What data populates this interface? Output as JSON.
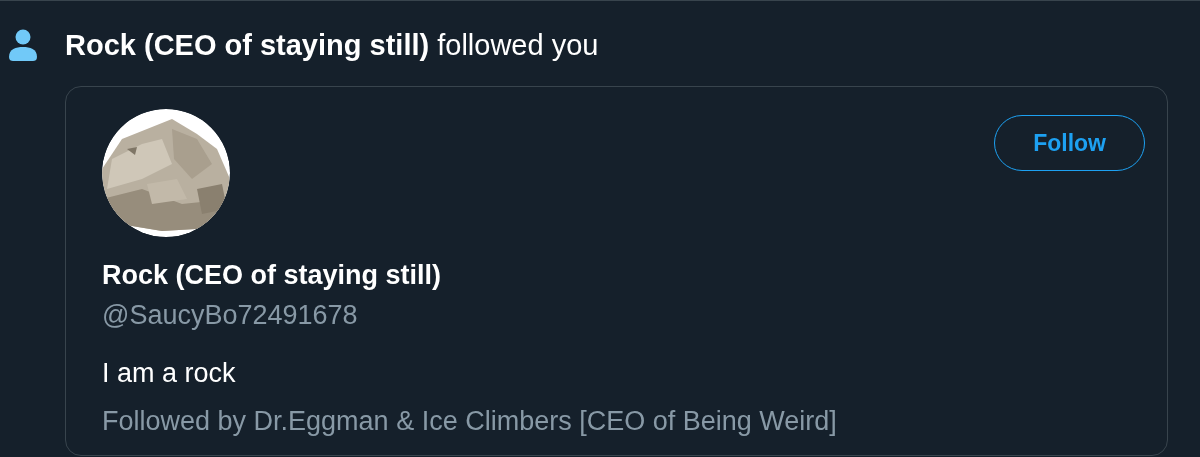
{
  "notification": {
    "text": "**Rock (CEO of staying still)** followed you"
  },
  "profile_card": {
    "follow_button": "Follow",
    "name": "Rock (CEO of staying still)",
    "handle": "@SaucyBo72491678",
    "bio": "I am a rock",
    "followed_by": "Followed by Dr.Eggman & Ice Climbers [CEO of Being Weird]"
  }
}
